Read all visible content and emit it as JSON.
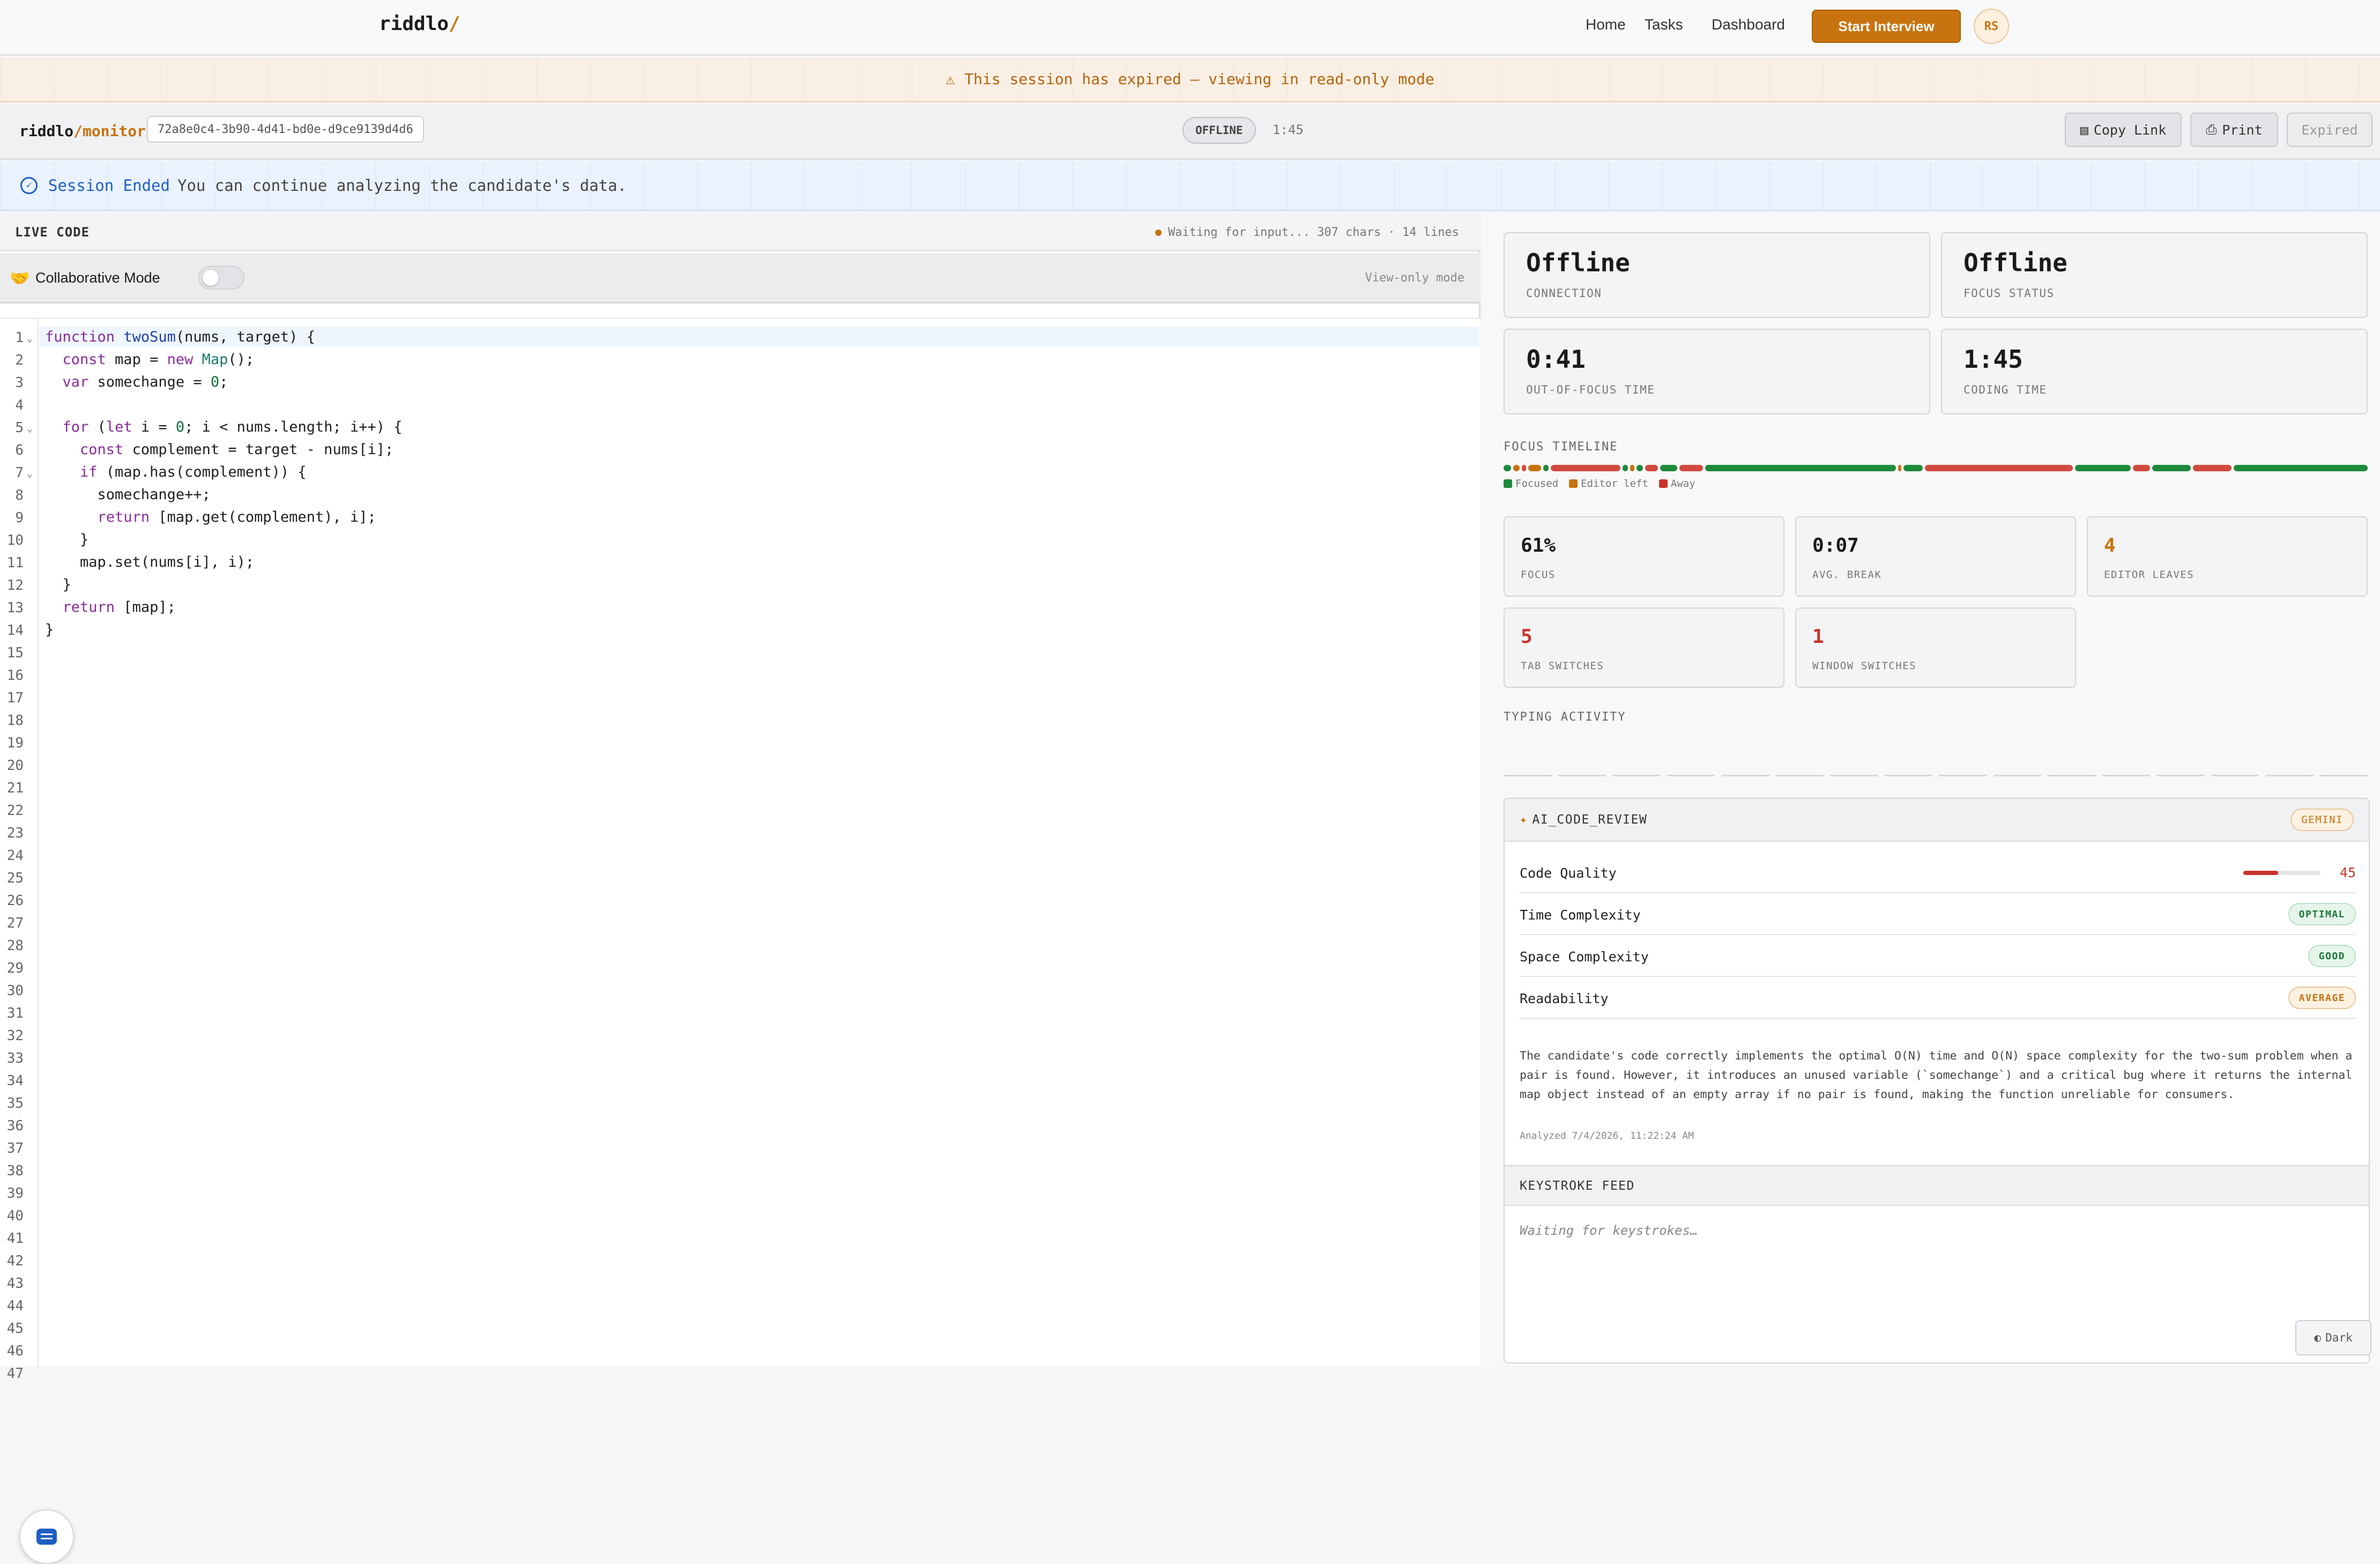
{
  "nav": {
    "logo": "riddlo",
    "logo_slash": "/",
    "links": [
      "Home",
      "Tasks",
      "Dashboard"
    ],
    "start_button": "Start Interview",
    "avatar": "RS"
  },
  "banner": {
    "icon": "warning-icon",
    "text": "This session has expired — viewing in read-only mode"
  },
  "monitor": {
    "title": "riddlo",
    "title_suffix": "/monitor",
    "session_id": "72a8e0c4-3b90-4d41-bd0e-d9ce9139d4d6",
    "status": "OFFLINE",
    "timer": "1:45",
    "copy_link": "Copy Link",
    "print": "Print",
    "expired": "Expired"
  },
  "session_ended": {
    "title": "Session Ended",
    "message": "You can continue analyzing the candidate's data."
  },
  "code_panel": {
    "title": "LIVE CODE",
    "status": "Waiting for input... 307 chars · 14 lines",
    "collab_label": "Collaborative Mode",
    "collab_on": false,
    "view_only": "View-only mode",
    "line_count": 47,
    "lines": [
      "function twoSum(nums, target) {",
      "  const map = new Map();",
      "  var somechange = 0;",
      "",
      "  for (let i = 0; i < nums.length; i++) {",
      "    const complement = target - nums[i];",
      "    if (map.has(complement)) {",
      "      somechange++;",
      "      return [map.get(complement), i];",
      "    }",
      "    map.set(nums[i], i);",
      "  }",
      "  return [map];",
      "}"
    ]
  },
  "stats": {
    "connection": {
      "value": "Offline",
      "label": "CONNECTION"
    },
    "focus_status": {
      "value": "Offline",
      "label": "FOCUS STATUS"
    },
    "out_of_focus": {
      "value": "0:41",
      "label": "OUT-OF-FOCUS TIME"
    },
    "coding_time": {
      "value": "1:45",
      "label": "CODING TIME"
    }
  },
  "timeline": {
    "title": "FOCUS TIMELINE",
    "legend": [
      "Focused",
      "Editor left",
      "Away"
    ],
    "colors": {
      "focused": "#1e8a3c",
      "editor_left": "#c8730f",
      "away": "#d04a3f"
    }
  },
  "metrics": {
    "focus": {
      "value": "61%",
      "label": "FOCUS"
    },
    "avg_break": {
      "value": "0:07",
      "label": "AVG. BREAK"
    },
    "editor_leaves": {
      "value": "4",
      "label": "EDITOR LEAVES"
    },
    "tab_switches": {
      "value": "5",
      "label": "TAB SWITCHES"
    },
    "window_switches": {
      "value": "1",
      "label": "WINDOW SWITCHES"
    }
  },
  "typing": {
    "title": "TYPING ACTIVITY"
  },
  "ai_review": {
    "title": "AI_CODE_REVIEW",
    "model": "GEMINI",
    "code_quality_label": "Code Quality",
    "code_quality": 45,
    "time_complexity_label": "Time Complexity",
    "time_complexity": "OPTIMAL",
    "space_complexity_label": "Space Complexity",
    "space_complexity": "GOOD",
    "readability_label": "Readability",
    "readability": "AVERAGE",
    "summary": "The candidate's code correctly implements the optimal O(N) time and O(N) space complexity for the two-sum problem when a pair is found. However, it introduces an unused variable (`somechange`) and a critical bug where it returns the internal map object instead of an empty array if no pair is found, making the function unreliable for consumers.",
    "analyzed": "Analyzed 7/4/2026, 11:22:24 AM"
  },
  "keystroke": {
    "title": "KEYSTROKE FEED",
    "empty": "Waiting for keystrokes…"
  },
  "theme_toggle": "Dark"
}
